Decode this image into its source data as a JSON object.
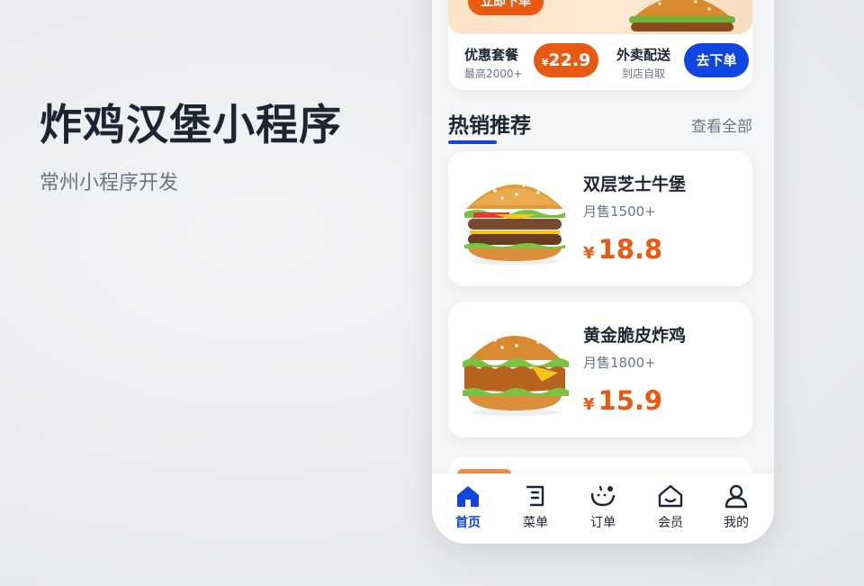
{
  "headline": {
    "title": "炸鸡汉堡小程序",
    "subtitle": "常州小程序开发"
  },
  "banner": {
    "order_now_label": "立即下单"
  },
  "promos": {
    "combo": {
      "title": "优惠套餐",
      "subtitle": "最高2000+",
      "currency": "¥",
      "price": "22.9"
    },
    "delivery": {
      "title": "外卖配送",
      "subtitle": "到店自取",
      "button_label": "去下单"
    }
  },
  "section": {
    "title": "热销推荐",
    "view_all": "查看全部"
  },
  "products": [
    {
      "name": "双层芝士牛堡",
      "sales": "月售1500+",
      "currency": "¥",
      "price": "18.8",
      "image_icon": "double-cheese-burger"
    },
    {
      "name": "黄金脆皮炸鸡",
      "sales": "月售1800+",
      "currency": "¥",
      "price": "15.9",
      "image_icon": "crispy-chicken-burger"
    }
  ],
  "tabbar": {
    "items": [
      {
        "label": "首页",
        "icon": "home-icon",
        "active": true
      },
      {
        "label": "菜单",
        "icon": "menu-icon",
        "active": false
      },
      {
        "label": "订单",
        "icon": "order-icon",
        "active": false
      },
      {
        "label": "会员",
        "icon": "member-icon",
        "active": false
      },
      {
        "label": "我的",
        "icon": "profile-icon",
        "active": false
      }
    ]
  },
  "colors": {
    "accent_orange": "#e85a12",
    "accent_blue": "#0f45e0",
    "text_dark": "#1d2433",
    "text_muted": "#6b7585"
  }
}
